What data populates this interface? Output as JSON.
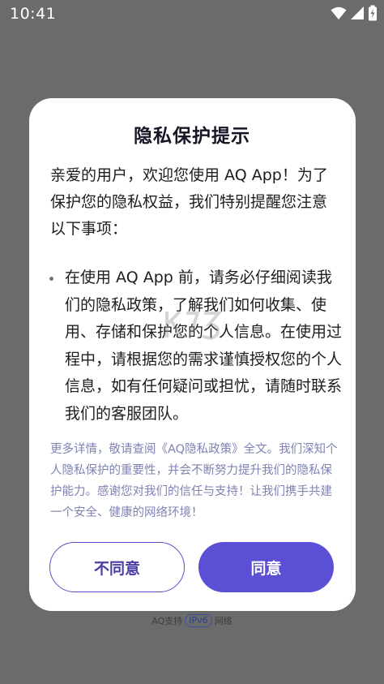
{
  "status_bar": {
    "time": "10:41"
  },
  "dialog": {
    "title": "隐私保护提示",
    "intro": "亲爱的用户，欢迎您使用 AQ App！为了保护您的隐私权益，我们特别提醒您注意以下事项：",
    "bullet": "在使用 AQ App 前，请务必仔细阅读我们的隐私政策，了解我们如何收集、使用、存储和保护您的个人信息。在使用过程中，请根据您的需求谨慎授权您的个人信息，如有任何疑问或担忧，请随时联系我们的客服团队。",
    "footer_note": "更多详情，敬请查阅《AQ隐私政策》全文。我们深知个人隐私保护的重要性，并会不断努力提升我们的隐私保护能力。感谢您对我们的信任与支持！让我们携手共建一个安全、健康的网络环境！",
    "disagree_label": "不同意",
    "agree_label": "同意"
  },
  "ipv6": {
    "prefix": "AQ支持",
    "badge": "IPv6",
    "suffix": "网络"
  },
  "colors": {
    "overlay": "#6b6b6b",
    "accent": "#5b4fd6",
    "note_text": "#7f83b3"
  },
  "icons": [
    "wifi-icon",
    "cellular-signal-icon",
    "battery-charging-icon"
  ]
}
